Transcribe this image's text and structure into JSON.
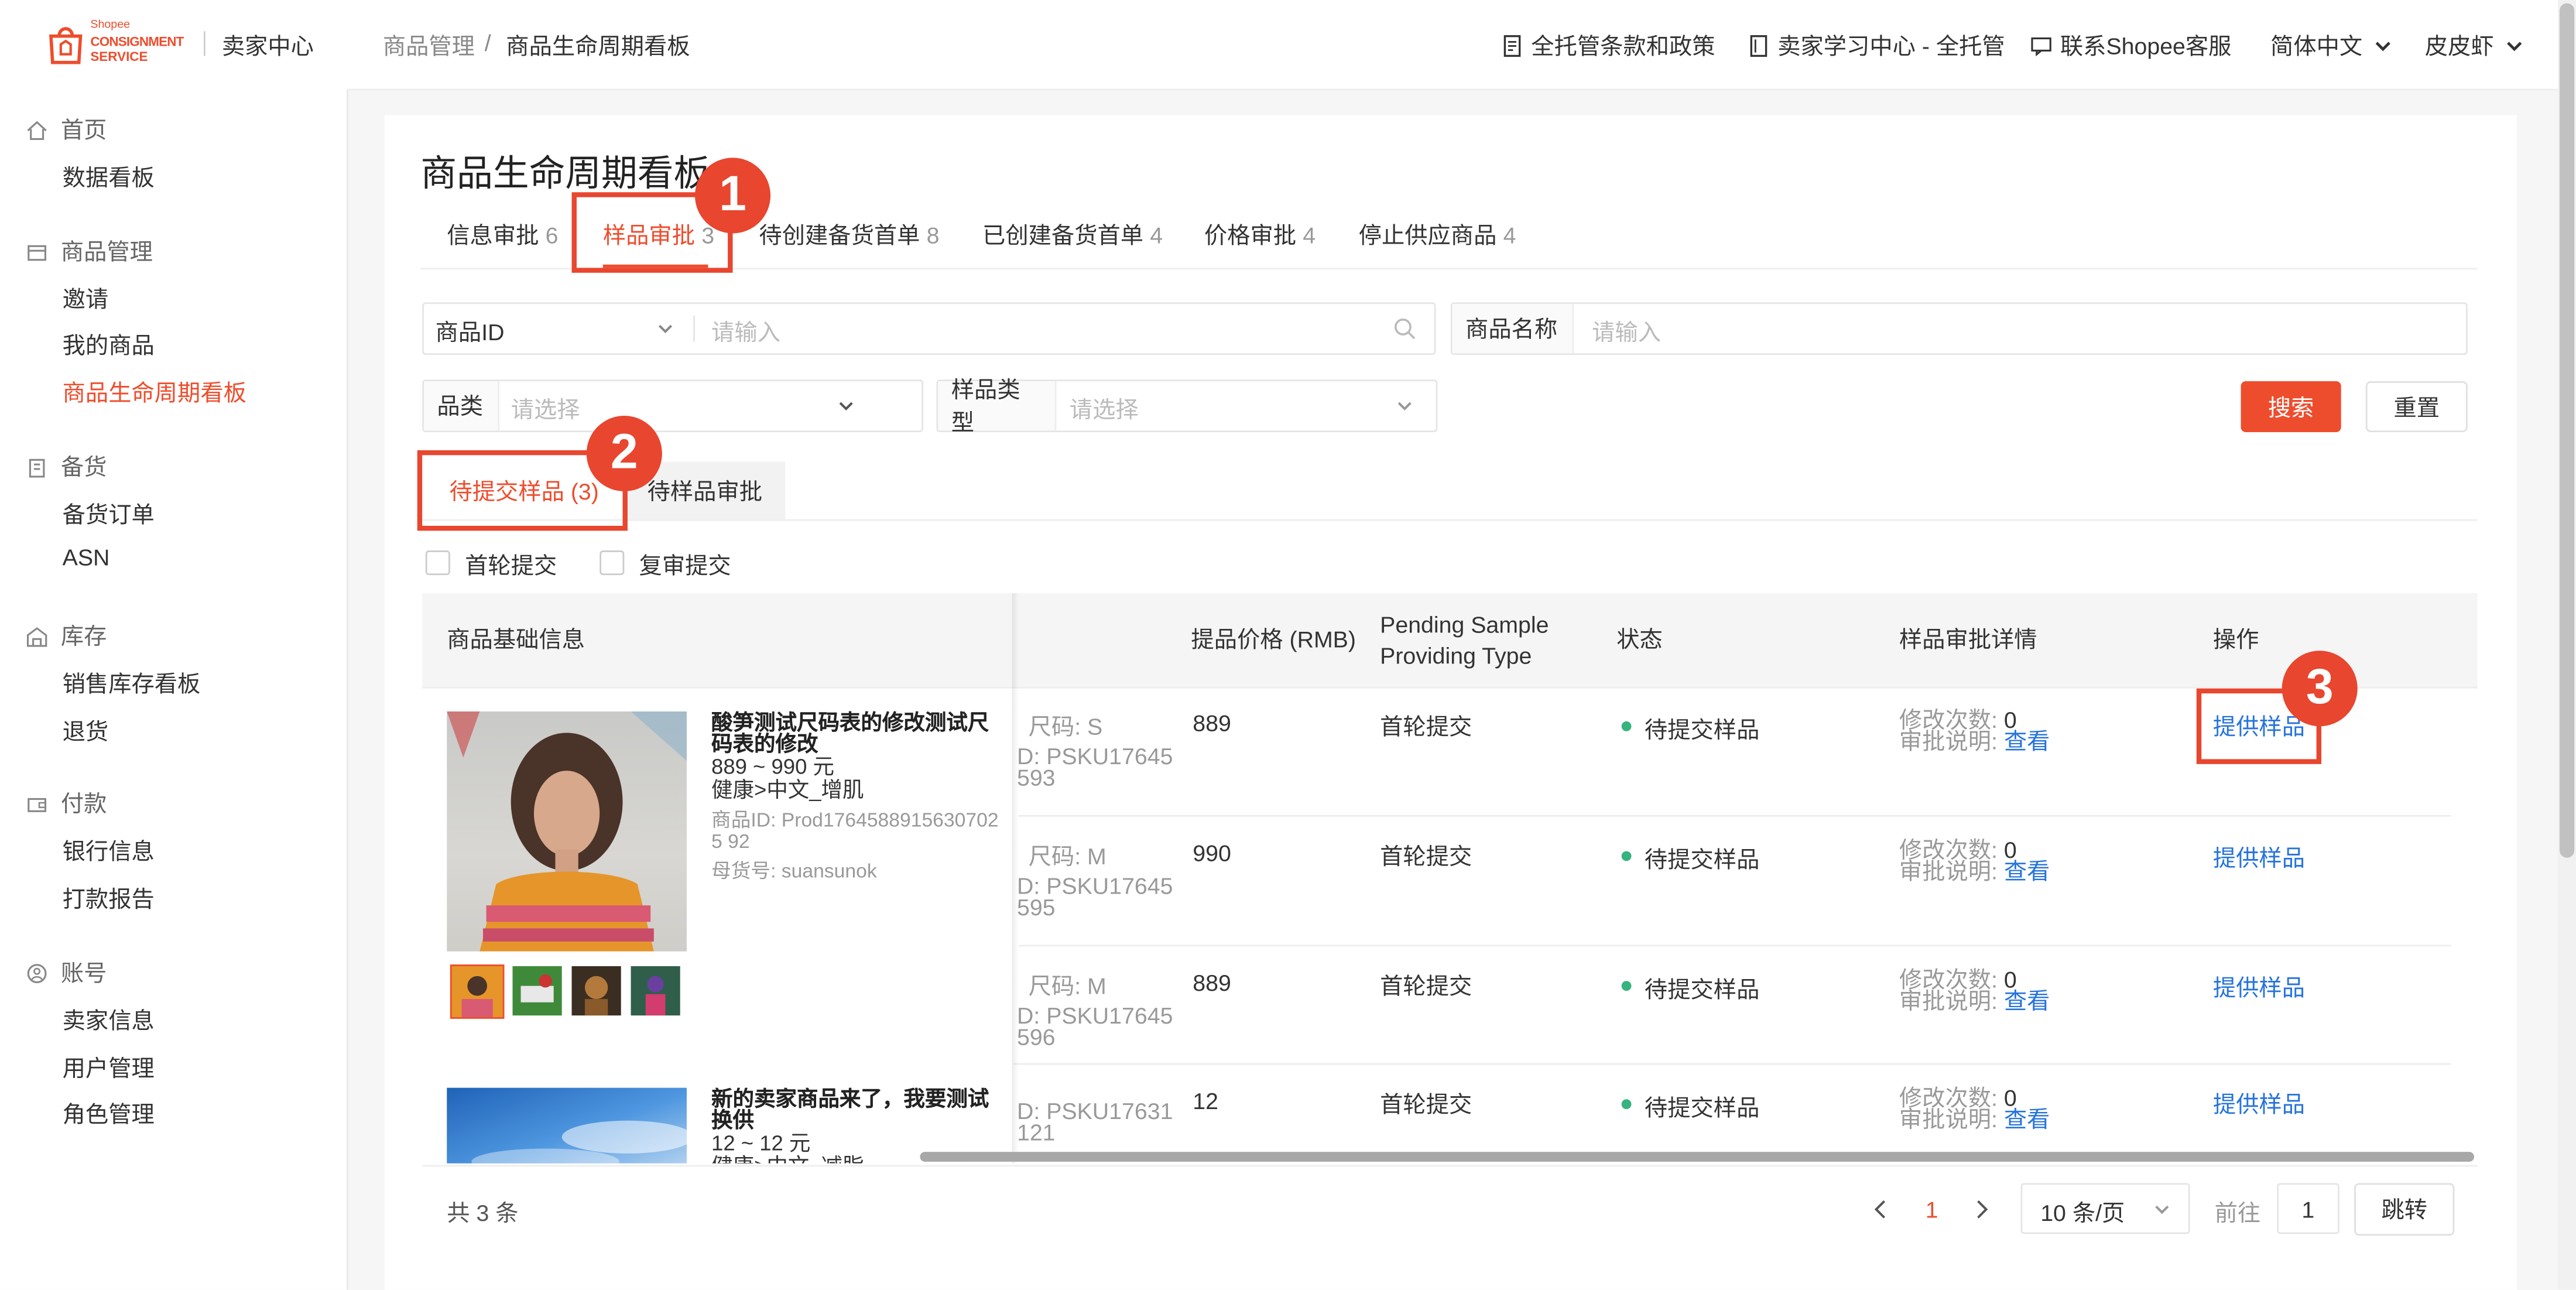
{
  "app": {
    "logo_brand": "Shopee",
    "logo_line1": "CONSIGNMENT",
    "logo_line2": "SERVICE",
    "seller_center": "卖家中心"
  },
  "sidebar": {
    "sections": [
      {
        "title": "首页",
        "icon": "home-icon",
        "items": [
          "数据看板"
        ]
      },
      {
        "title": "商品管理",
        "icon": "product-icon",
        "items": [
          "邀请",
          "我的商品",
          "商品生命周期看板"
        ]
      },
      {
        "title": "备货",
        "icon": "clipboard-icon",
        "items": [
          "备货订单",
          "ASN"
        ]
      },
      {
        "title": "库存",
        "icon": "warehouse-icon",
        "items": [
          "销售库存看板",
          "退货"
        ]
      },
      {
        "title": "付款",
        "icon": "wallet-icon",
        "items": [
          "银行信息",
          "打款报告"
        ]
      },
      {
        "title": "账号",
        "icon": "user-icon",
        "items": [
          "卖家信息",
          "用户管理",
          "角色管理"
        ]
      }
    ],
    "active_item": "商品生命周期看板"
  },
  "header": {
    "breadcrumb_root": "商品管理",
    "breadcrumb_sep": "/",
    "breadcrumb_current": "商品生命周期看板",
    "links": [
      "全托管条款和政策",
      "卖家学习中心 - 全托管",
      "联系Shopee客服"
    ],
    "language": "简体中文",
    "user": "皮皮虾"
  },
  "page": {
    "title": "商品生命周期看板",
    "tabs": [
      {
        "label": "信息审批",
        "count": "6"
      },
      {
        "label": "样品审批",
        "count": "3"
      },
      {
        "label": "待创建备货首单",
        "count": "8"
      },
      {
        "label": "已创建备货首单",
        "count": "4"
      },
      {
        "label": "价格审批",
        "count": "4"
      },
      {
        "label": "停止供应商品",
        "count": "4"
      }
    ],
    "active_tab": 1
  },
  "filters": {
    "product_id_select": "商品ID",
    "product_id_placeholder": "请输入",
    "product_name_label": "商品名称",
    "product_name_placeholder": "请输入",
    "category_label": "品类",
    "category_placeholder": "请选择",
    "sample_type_label": "样品类型",
    "sample_type_placeholder": "请选择",
    "search_button": "搜索",
    "reset_button": "重置"
  },
  "subtabs": {
    "pending_submit": "待提交样品 (3)",
    "pending_review": "待样品审批"
  },
  "checkboxes": {
    "first_round": "首轮提交",
    "re_review": "复审提交"
  },
  "table": {
    "headers": {
      "basic_info": "商品基础信息",
      "price": "提品价格 (RMB)",
      "providing_type_l1": "Pending Sample",
      "providing_type_l2": "Providing Type",
      "status": "状态",
      "detail": "样品审批详情",
      "action": "操作"
    },
    "product1": {
      "name": "酸笋测试尺码表的修改测试尺码表的修改",
      "price_range": "889 ~ 990 元",
      "category": "健康>中文_增肌",
      "product_id": "商品ID: Prod17645889156307025 92",
      "parent_sku": "母货号: suansunok"
    },
    "product2": {
      "name": "新的卖家商品来了，我要测试换供",
      "price_range": "12 ~ 12 元",
      "category": "健康>中文_减脂"
    },
    "rows": [
      {
        "size": "尺码: S",
        "sku_l1": "D: PSKU17645",
        "sku_l2": "593",
        "price": "889",
        "type": "首轮提交",
        "status": "待提交样品",
        "mods_label": "修改次数:",
        "mods": "0",
        "note_label": "审批说明:",
        "view": "查看",
        "action": "提供样品"
      },
      {
        "size": "尺码: M",
        "sku_l1": "D: PSKU17645",
        "sku_l2": "595",
        "price": "990",
        "type": "首轮提交",
        "status": "待提交样品",
        "mods_label": "修改次数:",
        "mods": "0",
        "note_label": "审批说明:",
        "view": "查看",
        "action": "提供样品"
      },
      {
        "size": "尺码: M",
        "sku_l1": "D: PSKU17645",
        "sku_l2": "596",
        "price": "889",
        "type": "首轮提交",
        "status": "待提交样品",
        "mods_label": "修改次数:",
        "mods": "0",
        "note_label": "审批说明:",
        "view": "查看",
        "action": "提供样品"
      },
      {
        "size": "",
        "sku_l1": "D: PSKU17631",
        "sku_l2": "121",
        "price": "12",
        "type": "首轮提交",
        "status": "待提交样品",
        "mods_label": "修改次数:",
        "mods": "0",
        "note_label": "审批说明:",
        "view": "查看",
        "action": "提供样品"
      }
    ]
  },
  "pagination": {
    "total": "共 3 条",
    "current_page": "1",
    "page_size": "10 条/页",
    "goto_label": "前往",
    "goto_value": "1",
    "jump_button": "跳转"
  },
  "callouts": [
    "1",
    "2",
    "3"
  ],
  "colors": {
    "brand": "#ee4d2d",
    "link": "#2673dd",
    "status_dot": "#36b37e",
    "callout": "#e8462f"
  }
}
